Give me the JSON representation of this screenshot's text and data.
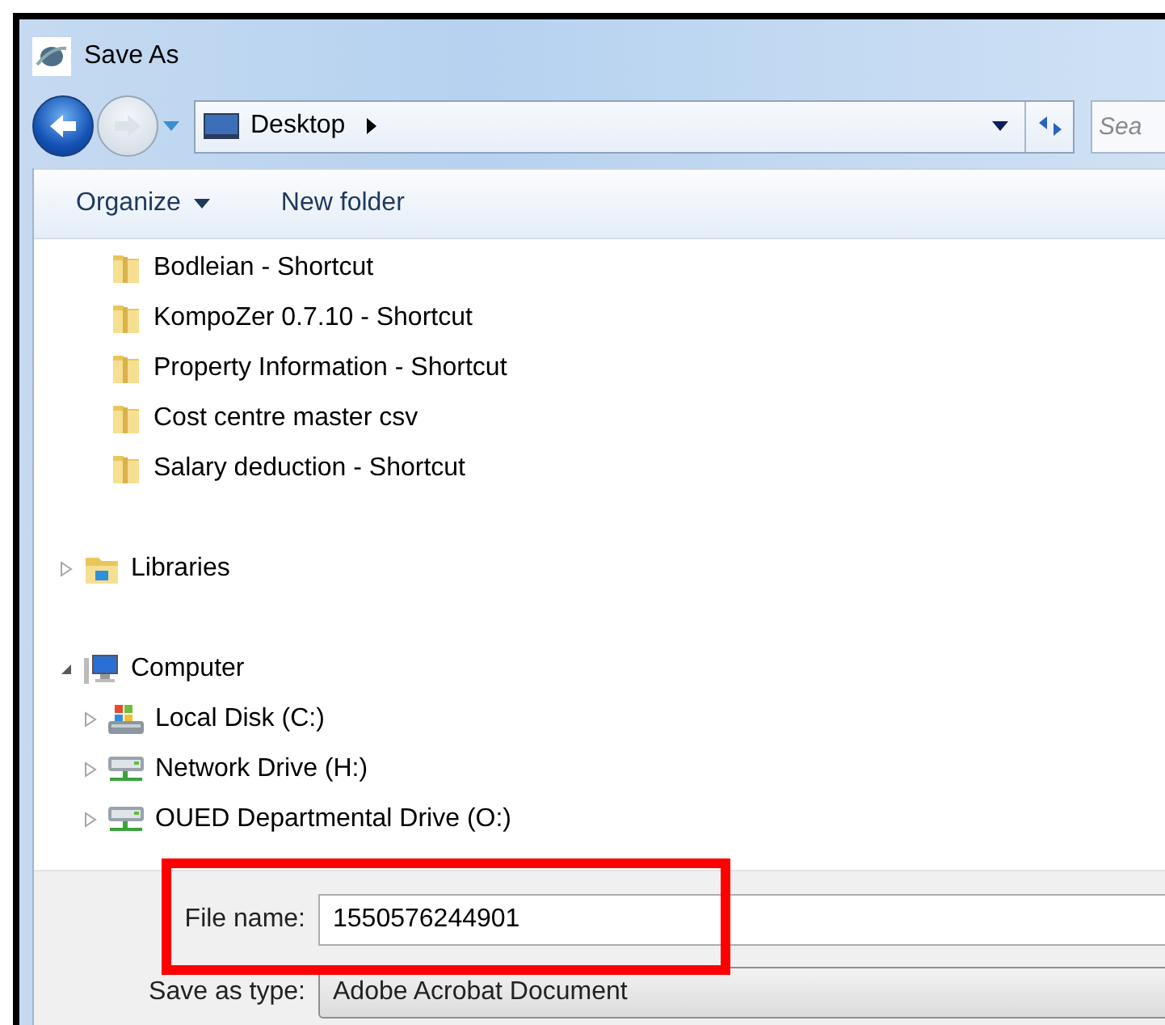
{
  "window": {
    "title": "Save As"
  },
  "address": {
    "location": "Desktop",
    "search_placeholder": "Sea"
  },
  "toolbar": [
    {
      "label": "Organize",
      "kind": "menu"
    },
    {
      "label": "New folder",
      "kind": "button"
    }
  ],
  "shortcuts": [
    {
      "label": "Bodleian - Shortcut"
    },
    {
      "label": "KompoZer 0.7.10 - Shortcut"
    },
    {
      "label": "Property Information - Shortcut"
    },
    {
      "label": "Cost centre master csv"
    },
    {
      "label": "Salary deduction - Shortcut"
    }
  ],
  "tree": [
    {
      "label": "Libraries",
      "kind": "library",
      "expanded": false
    },
    {
      "label": "Computer",
      "kind": "computer",
      "expanded": true,
      "children": [
        {
          "label": "Local Disk (C:)",
          "kind": "disk",
          "expanded": false
        },
        {
          "label": "Network Drive (H:)",
          "kind": "network",
          "expanded": false
        },
        {
          "label": "OUED Departmental Drive (O:)",
          "kind": "network",
          "expanded": false
        }
      ]
    }
  ],
  "file_name": {
    "label": "File name:",
    "value": "1550576244901"
  },
  "save_type": {
    "label": "Save as type:",
    "value": "Adobe Acrobat Document"
  }
}
